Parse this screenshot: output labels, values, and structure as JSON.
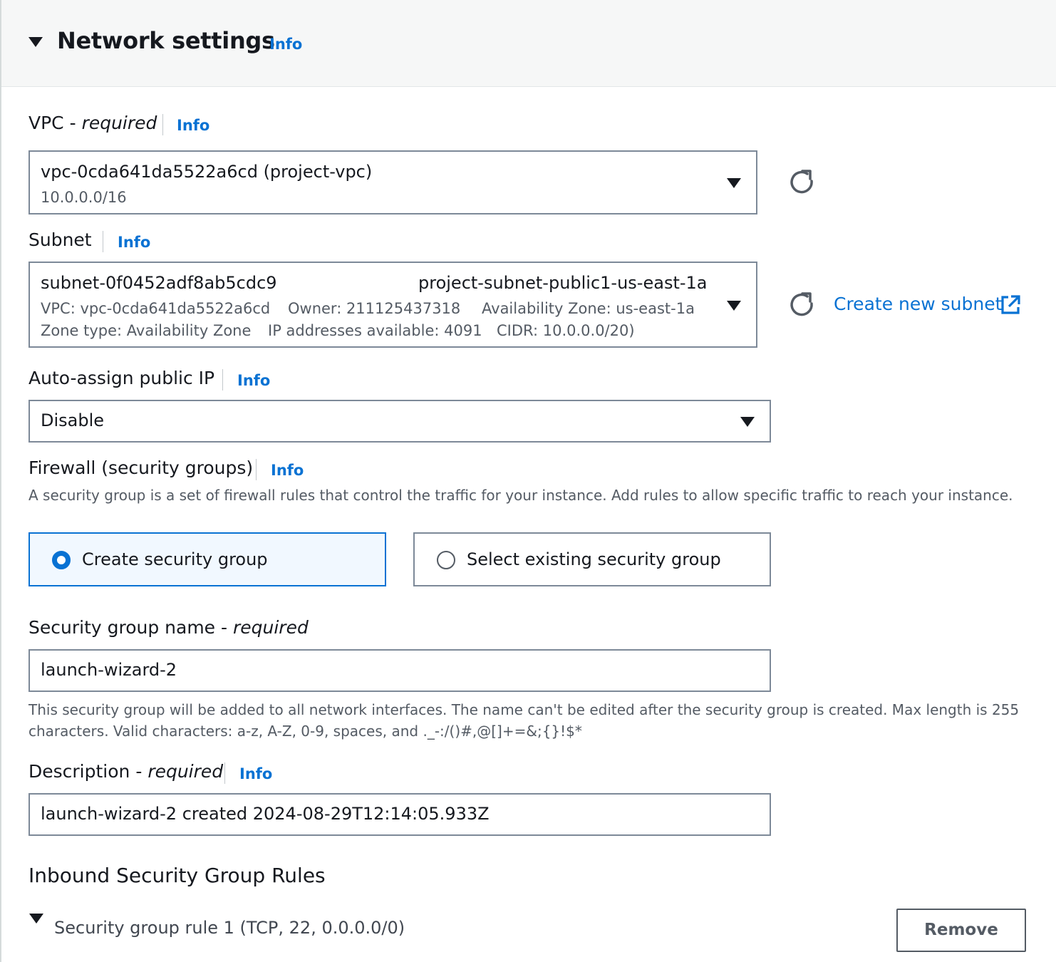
{
  "section": {
    "title": "Network settings",
    "info": "Info"
  },
  "vpc": {
    "label": "VPC - ",
    "required": "required",
    "info": "Info",
    "value": "vpc-0cda641da5522a6cd (project-vpc)",
    "cidr": "10.0.0.0/16"
  },
  "subnet": {
    "label": "Subnet",
    "info": "Info",
    "id": "subnet-0f0452adf8ab5cdc9",
    "name": "project-subnet-public1-us-east-1a",
    "vpc": "VPC: vpc-0cda641da5522a6cd",
    "owner": "Owner: 211125437318",
    "az": "Availability Zone: us-east-1a",
    "zone_type": "Zone type: Availability Zone",
    "ips": "IP addresses available: 4091",
    "cidr": "CIDR: 10.0.0.0/20)",
    "create_link": "Create new subnet"
  },
  "public_ip": {
    "label": "Auto-assign public IP",
    "info": "Info",
    "value": "Disable"
  },
  "firewall": {
    "label": "Firewall (security groups)",
    "info": "Info",
    "help": "A security group is a set of firewall rules that control the traffic for your instance. Add rules to allow specific traffic to reach your instance.",
    "option_create": "Create security group",
    "option_existing": "Select existing security group",
    "selected": "create"
  },
  "sg_name": {
    "label": "Security group name - ",
    "required": "required",
    "value": "launch-wizard-2",
    "help": "This security group will be added to all network interfaces. The name can't be edited after the security group is created. Max length is 255 characters. Valid characters: a-z, A-Z, 0-9, spaces, and ._-:/()#,@[]+=&;{}!$*"
  },
  "description": {
    "label": "Description - ",
    "required": "required",
    "info": "Info",
    "value": "launch-wizard-2 created 2024-08-29T12:14:05.933Z"
  },
  "inbound": {
    "title": "Inbound Security Group Rules",
    "rule_1": "Security group rule 1 (TCP, 22, 0.0.0.0/0)",
    "remove": "Remove"
  },
  "colors": {
    "link": "#0972d3",
    "border": "#7d8998",
    "header_bg": "#f6f7f7"
  }
}
